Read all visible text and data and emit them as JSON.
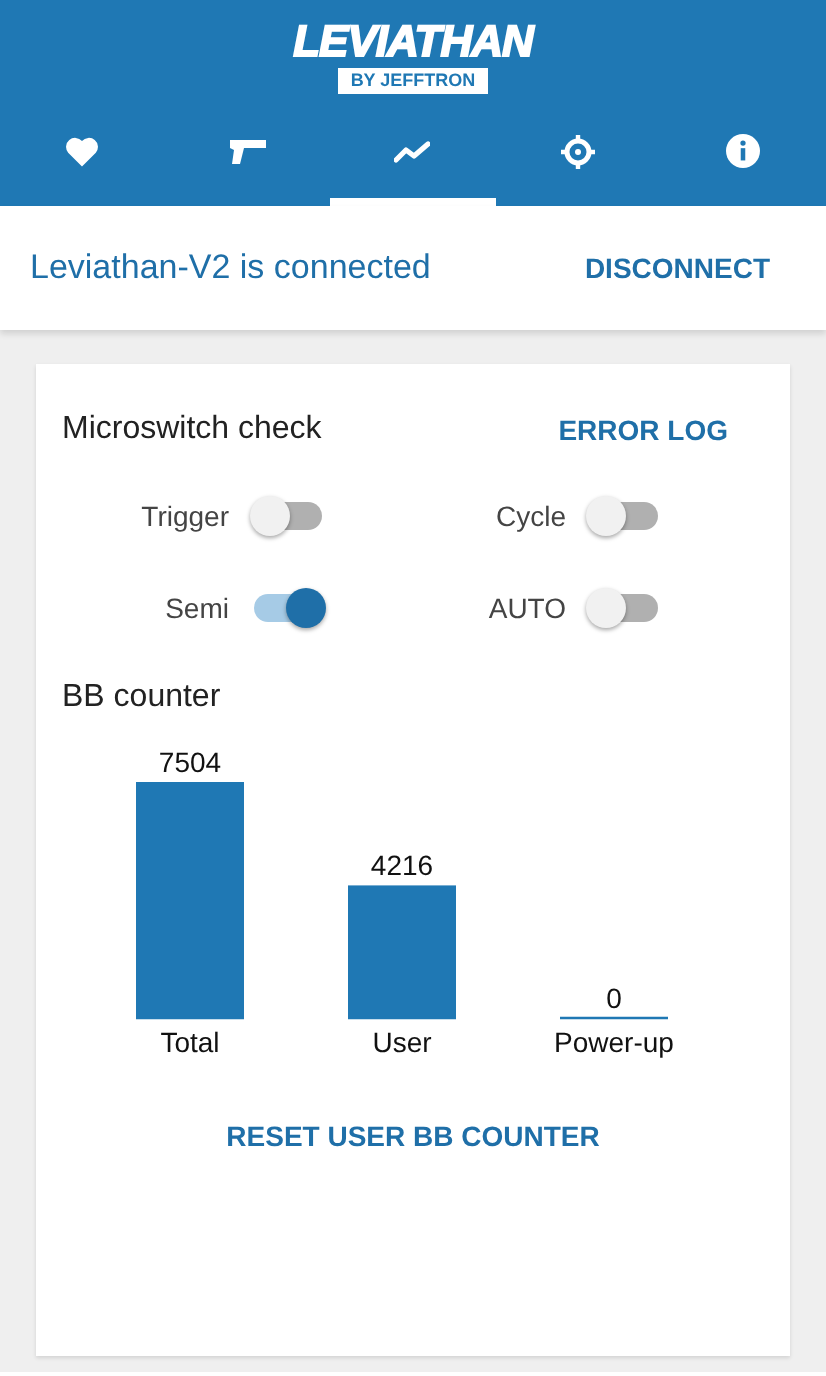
{
  "header": {
    "logo": {
      "title": "LEVIATHAN",
      "subtitle": "BY JEFFTRON"
    },
    "tabs": [
      {
        "selected": false
      },
      {
        "selected": false
      },
      {
        "selected": true
      },
      {
        "selected": false
      },
      {
        "selected": false
      }
    ]
  },
  "connection": {
    "status": "Leviathan-V2 is connected",
    "action": "DISCONNECT"
  },
  "microswitch": {
    "title": "Microswitch check",
    "action": "ERROR LOG",
    "switches": [
      {
        "label": "Trigger",
        "on": false
      },
      {
        "label": "Cycle",
        "on": false
      },
      {
        "label": "Semi",
        "on": true
      },
      {
        "label": "AUTO",
        "on": false
      }
    ]
  },
  "bb_counter": {
    "title": "BB counter",
    "chart_data": {
      "type": "bar",
      "categories": [
        "Total",
        "User",
        "Power-up"
      ],
      "data_labels": true,
      "series": [
        {
          "color": "#1f78b4",
          "values": [
            7504,
            4216,
            0
          ]
        }
      ]
    },
    "action": "RESET USER BB COUNTER"
  }
}
